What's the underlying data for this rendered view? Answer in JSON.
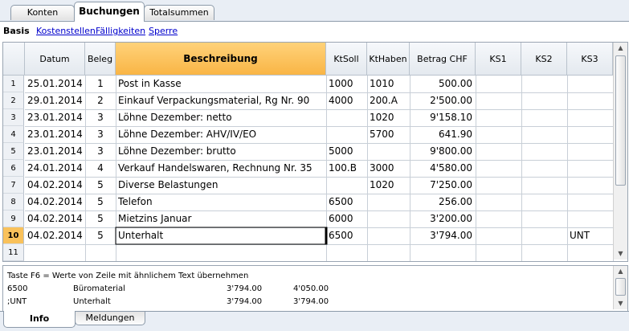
{
  "tabs": [
    {
      "label": "Konten"
    },
    {
      "label": "Buchungen"
    },
    {
      "label": "Totalsummen"
    }
  ],
  "subtabs": [
    {
      "label": "Basis"
    },
    {
      "label": "Kostenstellen"
    },
    {
      "label": "Fälligkeiten"
    },
    {
      "label": "Sperre"
    }
  ],
  "table": {
    "headers": [
      "Datum",
      "Beleg",
      "Beschreibung",
      "KtSoll",
      "KtHaben",
      "Betrag CHF",
      "KS1",
      "KS2",
      "KS3"
    ],
    "rows": [
      {
        "num": "1",
        "datum": "25.01.2014",
        "beleg": "1",
        "beschreibung": "Post in Kasse",
        "ktsoll": "1000",
        "kthaben": "1010",
        "betrag": "500.00",
        "ks1": "",
        "ks2": "",
        "ks3": ""
      },
      {
        "num": "2",
        "datum": "29.01.2014",
        "beleg": "2",
        "beschreibung": "Einkauf Verpackungsmaterial, Rg Nr. 90",
        "ktsoll": "4000",
        "kthaben": "200.A",
        "betrag": "2'500.00",
        "ks1": "",
        "ks2": "",
        "ks3": ""
      },
      {
        "num": "3",
        "datum": "23.01.2014",
        "beleg": "3",
        "beschreibung": "Löhne Dezember: netto",
        "ktsoll": "",
        "kthaben": "1020",
        "betrag": "9'158.10",
        "ks1": "",
        "ks2": "",
        "ks3": ""
      },
      {
        "num": "4",
        "datum": "23.01.2014",
        "beleg": "3",
        "beschreibung": "Löhne Dezember: AHV/IV/EO",
        "ktsoll": "",
        "kthaben": "5700",
        "betrag": "641.90",
        "ks1": "",
        "ks2": "",
        "ks3": ""
      },
      {
        "num": "5",
        "datum": "23.01.2014",
        "beleg": "3",
        "beschreibung": "Löhne Dezember: brutto",
        "ktsoll": "5000",
        "kthaben": "",
        "betrag": "9'800.00",
        "ks1": "",
        "ks2": "",
        "ks3": ""
      },
      {
        "num": "6",
        "datum": "24.01.2014",
        "beleg": "4",
        "beschreibung": "Verkauf Handelswaren, Rechnung Nr. 35",
        "ktsoll": "100.B",
        "kthaben": "3000",
        "betrag": "4'580.00",
        "ks1": "",
        "ks2": "",
        "ks3": ""
      },
      {
        "num": "7",
        "datum": "04.02.2014",
        "beleg": "5",
        "beschreibung": "Diverse Belastungen",
        "ktsoll": "",
        "kthaben": "1020",
        "betrag": "7'250.00",
        "ks1": "",
        "ks2": "",
        "ks3": ""
      },
      {
        "num": "8",
        "datum": "04.02.2014",
        "beleg": "5",
        "beschreibung": "Telefon",
        "ktsoll": "6500",
        "kthaben": "",
        "betrag": "256.00",
        "ks1": "",
        "ks2": "",
        "ks3": ""
      },
      {
        "num": "9",
        "datum": "04.02.2014",
        "beleg": "5",
        "beschreibung": "Mietzins Januar",
        "ktsoll": "6000",
        "kthaben": "",
        "betrag": "3'200.00",
        "ks1": "",
        "ks2": "",
        "ks3": ""
      },
      {
        "num": "10",
        "datum": "04.02.2014",
        "beleg": "5",
        "beschreibung": "Unterhalt",
        "ktsoll": "6500",
        "kthaben": "",
        "betrag": "3'794.00",
        "ks1": "",
        "ks2": "",
        "ks3": "UNT"
      },
      {
        "num": "11",
        "datum": "",
        "beleg": "",
        "beschreibung": "",
        "ktsoll": "",
        "kthaben": "",
        "betrag": "",
        "ks1": "",
        "ks2": "",
        "ks3": ""
      }
    ]
  },
  "info": {
    "hint": "Taste F6 = Werte von Zeile mit ähnlichem Text übernehmen",
    "lines": [
      {
        "code": "6500",
        "name": "Büromaterial",
        "v1": "3'794.00",
        "v2": "4'050.00"
      },
      {
        "code": ";UNT",
        "name": "Unterhalt",
        "v1": "3'794.00",
        "v2": "3'794.00"
      }
    ]
  },
  "bottom_tabs": [
    {
      "label": "Info"
    },
    {
      "label": "Meldungen"
    }
  ]
}
